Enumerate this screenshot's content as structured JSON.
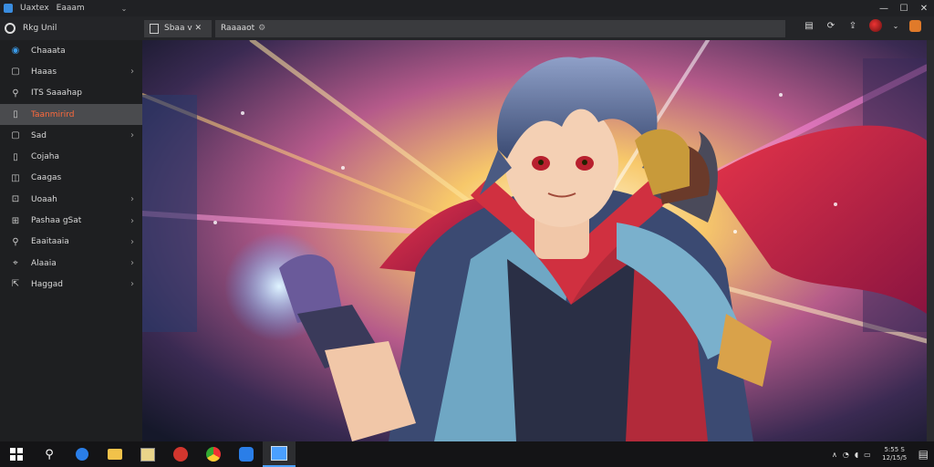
{
  "window": {
    "title_a": "Uaxtex",
    "title_b": "Eaaam",
    "caret": "⌄"
  },
  "toolbar": {
    "brand_label": "Rkg  Unil",
    "tab_label": "Sbaa v ✕",
    "address": "Raaaaot",
    "address_icon": "⚙"
  },
  "sidebar": {
    "items": [
      {
        "icon": "blue-sphere-icon",
        "glyph": "◉",
        "label": "Chaaata",
        "chevron": false,
        "active": false
      },
      {
        "icon": "folder-icon",
        "glyph": "▢",
        "label": "Haaas",
        "chevron": true,
        "active": false
      },
      {
        "icon": "gallery-icon",
        "glyph": "⚲",
        "label": "ITS Saaahap",
        "chevron": false,
        "active": false
      },
      {
        "icon": "page-icon",
        "glyph": "▯",
        "label": "Taanmirird",
        "chevron": false,
        "active": true
      },
      {
        "icon": "square-icon",
        "glyph": "▢",
        "label": "Sad",
        "chevron": true,
        "active": false
      },
      {
        "icon": "trash-icon",
        "glyph": "▯",
        "label": "Cojaha",
        "chevron": false,
        "active": false
      },
      {
        "icon": "camera-icon",
        "glyph": "◫",
        "label": "Caagas",
        "chevron": false,
        "active": false
      },
      {
        "icon": "device-icon",
        "glyph": "⊡",
        "label": "Uoaah",
        "chevron": true,
        "active": false
      },
      {
        "icon": "photo-icon",
        "glyph": "⊞",
        "label": "Pashaa gSat",
        "chevron": true,
        "active": false
      },
      {
        "icon": "search-icon",
        "glyph": "⚲",
        "label": "Eaaitaaia",
        "chevron": true,
        "active": false
      },
      {
        "icon": "pin-icon",
        "glyph": "⌖",
        "label": "Alaaia",
        "chevron": true,
        "active": false
      },
      {
        "icon": "share-icon",
        "glyph": "⇱",
        "label": "Haggad",
        "chevron": true,
        "active": false
      }
    ]
  },
  "taskbar": {
    "apps": [
      "windows-start-icon",
      "search-icon",
      "edge-icon",
      "file-explorer-icon",
      "photos-icon",
      "red-app-icon",
      "chrome-icon",
      "blue-app-icon",
      "active-app-icon"
    ],
    "clock_time": "5:55 S",
    "clock_date": "12/15/5"
  },
  "colors": {
    "accent": "#ff6a3d",
    "active_bg": "#4a4b4e",
    "taskbar_accent": "#4aa0ff"
  }
}
